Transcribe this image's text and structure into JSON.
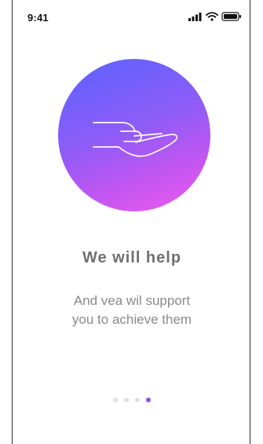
{
  "status_bar": {
    "time": "9:41",
    "icons": [
      "signal-icon",
      "wifi-icon",
      "battery-icon"
    ]
  },
  "hero": {
    "icon": "hand-icon",
    "gradient": [
      "#5a63ff",
      "#ef5cf0"
    ]
  },
  "content": {
    "title": "We will help",
    "subtitle_line_1": "And vea wil support",
    "subtitle_line_2": "you to achieve them"
  },
  "pager": {
    "total_pages": 4,
    "active_page": 4,
    "active_color": "#8c4df1",
    "inactive_color": "#e3e3e3"
  }
}
